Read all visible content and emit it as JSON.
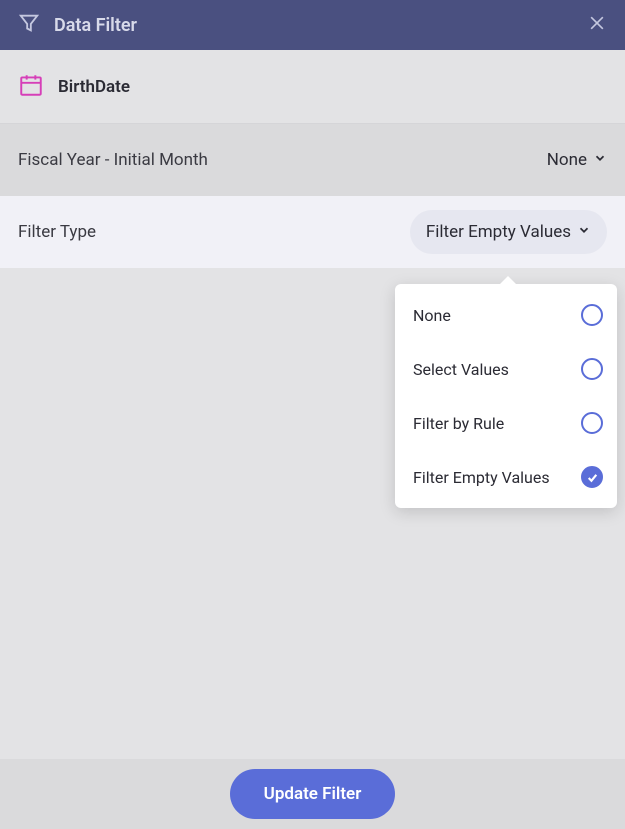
{
  "header": {
    "title": "Data Filter"
  },
  "field": {
    "name": "BirthDate"
  },
  "fiscal": {
    "label": "Fiscal Year - Initial Month",
    "value": "None"
  },
  "filterType": {
    "label": "Filter Type",
    "selected": "Filter Empty Values",
    "options": [
      {
        "label": "None",
        "selected": false
      },
      {
        "label": "Select Values",
        "selected": false
      },
      {
        "label": "Filter by Rule",
        "selected": false
      },
      {
        "label": "Filter Empty Values",
        "selected": true
      }
    ]
  },
  "footer": {
    "updateLabel": "Update Filter"
  }
}
